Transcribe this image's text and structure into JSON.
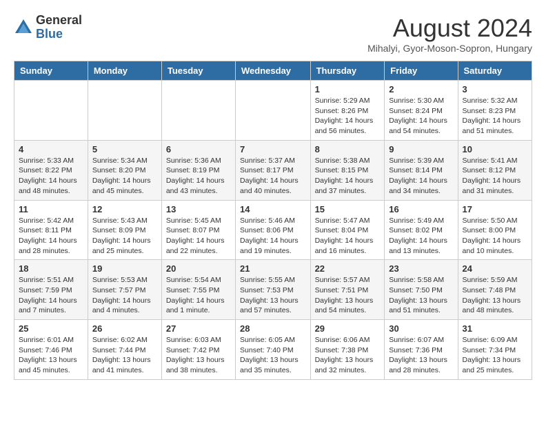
{
  "logo": {
    "general": "General",
    "blue": "Blue"
  },
  "title": {
    "month_year": "August 2024",
    "location": "Mihalyi, Gyor-Moson-Sopron, Hungary"
  },
  "days_of_week": [
    "Sunday",
    "Monday",
    "Tuesday",
    "Wednesday",
    "Thursday",
    "Friday",
    "Saturday"
  ],
  "weeks": [
    {
      "days": [
        {
          "num": "",
          "info": ""
        },
        {
          "num": "",
          "info": ""
        },
        {
          "num": "",
          "info": ""
        },
        {
          "num": "",
          "info": ""
        },
        {
          "num": "1",
          "info": "Sunrise: 5:29 AM\nSunset: 8:26 PM\nDaylight: 14 hours\nand 56 minutes."
        },
        {
          "num": "2",
          "info": "Sunrise: 5:30 AM\nSunset: 8:24 PM\nDaylight: 14 hours\nand 54 minutes."
        },
        {
          "num": "3",
          "info": "Sunrise: 5:32 AM\nSunset: 8:23 PM\nDaylight: 14 hours\nand 51 minutes."
        }
      ]
    },
    {
      "days": [
        {
          "num": "4",
          "info": "Sunrise: 5:33 AM\nSunset: 8:22 PM\nDaylight: 14 hours\nand 48 minutes."
        },
        {
          "num": "5",
          "info": "Sunrise: 5:34 AM\nSunset: 8:20 PM\nDaylight: 14 hours\nand 45 minutes."
        },
        {
          "num": "6",
          "info": "Sunrise: 5:36 AM\nSunset: 8:19 PM\nDaylight: 14 hours\nand 43 minutes."
        },
        {
          "num": "7",
          "info": "Sunrise: 5:37 AM\nSunset: 8:17 PM\nDaylight: 14 hours\nand 40 minutes."
        },
        {
          "num": "8",
          "info": "Sunrise: 5:38 AM\nSunset: 8:15 PM\nDaylight: 14 hours\nand 37 minutes."
        },
        {
          "num": "9",
          "info": "Sunrise: 5:39 AM\nSunset: 8:14 PM\nDaylight: 14 hours\nand 34 minutes."
        },
        {
          "num": "10",
          "info": "Sunrise: 5:41 AM\nSunset: 8:12 PM\nDaylight: 14 hours\nand 31 minutes."
        }
      ]
    },
    {
      "days": [
        {
          "num": "11",
          "info": "Sunrise: 5:42 AM\nSunset: 8:11 PM\nDaylight: 14 hours\nand 28 minutes."
        },
        {
          "num": "12",
          "info": "Sunrise: 5:43 AM\nSunset: 8:09 PM\nDaylight: 14 hours\nand 25 minutes."
        },
        {
          "num": "13",
          "info": "Sunrise: 5:45 AM\nSunset: 8:07 PM\nDaylight: 14 hours\nand 22 minutes."
        },
        {
          "num": "14",
          "info": "Sunrise: 5:46 AM\nSunset: 8:06 PM\nDaylight: 14 hours\nand 19 minutes."
        },
        {
          "num": "15",
          "info": "Sunrise: 5:47 AM\nSunset: 8:04 PM\nDaylight: 14 hours\nand 16 minutes."
        },
        {
          "num": "16",
          "info": "Sunrise: 5:49 AM\nSunset: 8:02 PM\nDaylight: 14 hours\nand 13 minutes."
        },
        {
          "num": "17",
          "info": "Sunrise: 5:50 AM\nSunset: 8:00 PM\nDaylight: 14 hours\nand 10 minutes."
        }
      ]
    },
    {
      "days": [
        {
          "num": "18",
          "info": "Sunrise: 5:51 AM\nSunset: 7:59 PM\nDaylight: 14 hours\nand 7 minutes."
        },
        {
          "num": "19",
          "info": "Sunrise: 5:53 AM\nSunset: 7:57 PM\nDaylight: 14 hours\nand 4 minutes."
        },
        {
          "num": "20",
          "info": "Sunrise: 5:54 AM\nSunset: 7:55 PM\nDaylight: 14 hours\nand 1 minute."
        },
        {
          "num": "21",
          "info": "Sunrise: 5:55 AM\nSunset: 7:53 PM\nDaylight: 13 hours\nand 57 minutes."
        },
        {
          "num": "22",
          "info": "Sunrise: 5:57 AM\nSunset: 7:51 PM\nDaylight: 13 hours\nand 54 minutes."
        },
        {
          "num": "23",
          "info": "Sunrise: 5:58 AM\nSunset: 7:50 PM\nDaylight: 13 hours\nand 51 minutes."
        },
        {
          "num": "24",
          "info": "Sunrise: 5:59 AM\nSunset: 7:48 PM\nDaylight: 13 hours\nand 48 minutes."
        }
      ]
    },
    {
      "days": [
        {
          "num": "25",
          "info": "Sunrise: 6:01 AM\nSunset: 7:46 PM\nDaylight: 13 hours\nand 45 minutes."
        },
        {
          "num": "26",
          "info": "Sunrise: 6:02 AM\nSunset: 7:44 PM\nDaylight: 13 hours\nand 41 minutes."
        },
        {
          "num": "27",
          "info": "Sunrise: 6:03 AM\nSunset: 7:42 PM\nDaylight: 13 hours\nand 38 minutes."
        },
        {
          "num": "28",
          "info": "Sunrise: 6:05 AM\nSunset: 7:40 PM\nDaylight: 13 hours\nand 35 minutes."
        },
        {
          "num": "29",
          "info": "Sunrise: 6:06 AM\nSunset: 7:38 PM\nDaylight: 13 hours\nand 32 minutes."
        },
        {
          "num": "30",
          "info": "Sunrise: 6:07 AM\nSunset: 7:36 PM\nDaylight: 13 hours\nand 28 minutes."
        },
        {
          "num": "31",
          "info": "Sunrise: 6:09 AM\nSunset: 7:34 PM\nDaylight: 13 hours\nand 25 minutes."
        }
      ]
    }
  ]
}
